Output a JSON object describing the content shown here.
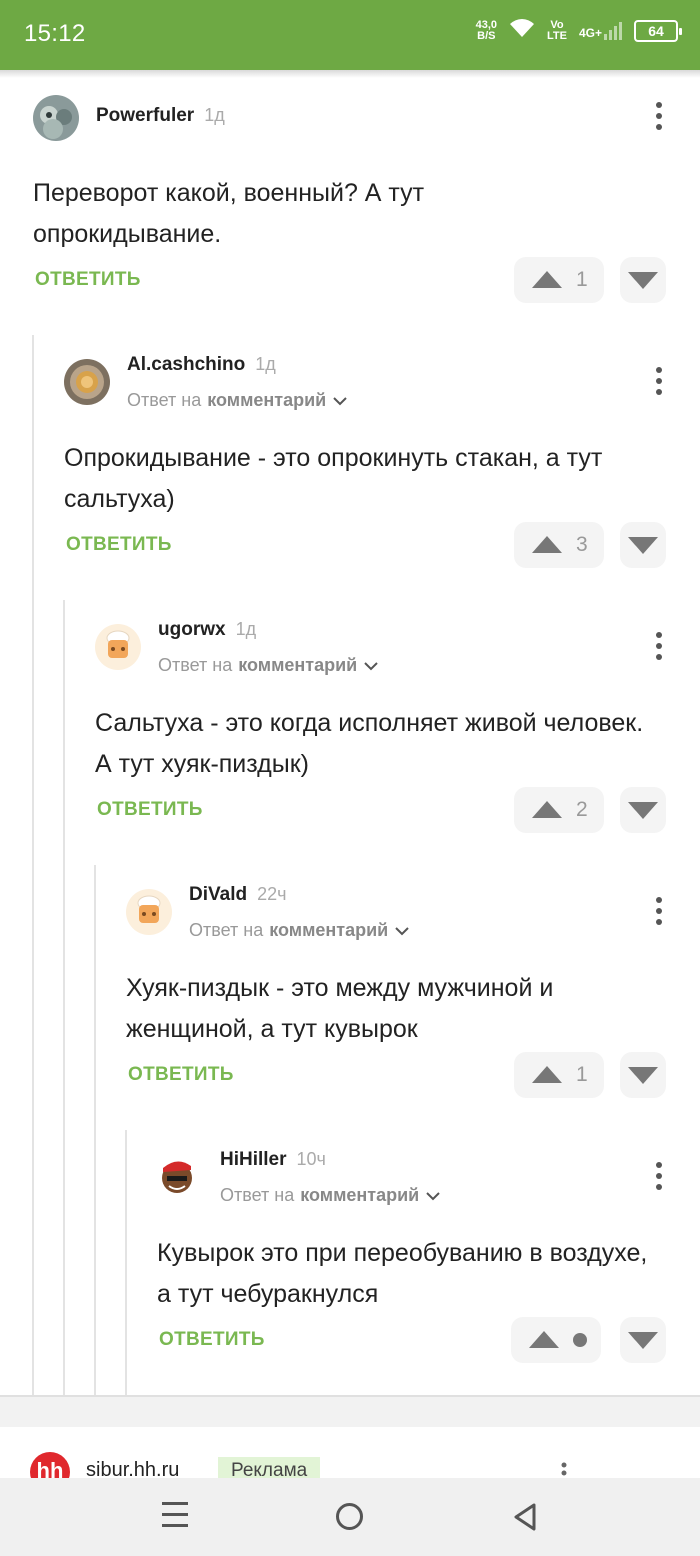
{
  "status_bar": {
    "time": "15:12",
    "net_speed_value": "43,0",
    "net_speed_unit": "B/S",
    "volte_line1": "Vo",
    "volte_line2": "LTE",
    "network": "4G+",
    "battery": "64"
  },
  "reply_label": "ОТВЕТИТЬ",
  "reply_to_prefix": "Ответ на",
  "reply_to_target": "комментарий",
  "comments": [
    {
      "username": "Powerfuler",
      "time": "1д",
      "text": "Переворот какой, военный? А тут опрокидывание.",
      "votes": "1"
    },
    {
      "username": "Al.cashchino",
      "time": "1д",
      "text": "Опрокидывание - это опрокинуть стакан, а тут сальтуха)",
      "votes": "3"
    },
    {
      "username": "ugorwx",
      "time": "1д",
      "text": "Сальтуха - это когда исполняет живой человек. А тут хуяк-пиздык)",
      "votes": "2"
    },
    {
      "username": "DiVald",
      "time": "22ч",
      "text": "Хуяк-пиздык - это между мужчиной и женщиной, а тут кувырок",
      "votes": "1"
    },
    {
      "username": "HiHiller",
      "time": "10ч",
      "text": "Кувырок это при переобуванию в воздухе, а тут чебуракнулся",
      "votes": ""
    }
  ],
  "ad": {
    "logo_text": "hh",
    "domain": "sibur.hh.ru",
    "badge": "Реклама"
  },
  "colors": {
    "brand_green": "#6ea944",
    "reply_green": "#7ab851"
  },
  "icons": [
    "wifi-icon",
    "signal-icon",
    "battery-icon",
    "more-vertical-icon",
    "chevron-down-icon",
    "upvote-icon",
    "downvote-icon",
    "nav-menu-icon",
    "nav-home-icon",
    "nav-back-icon"
  ]
}
